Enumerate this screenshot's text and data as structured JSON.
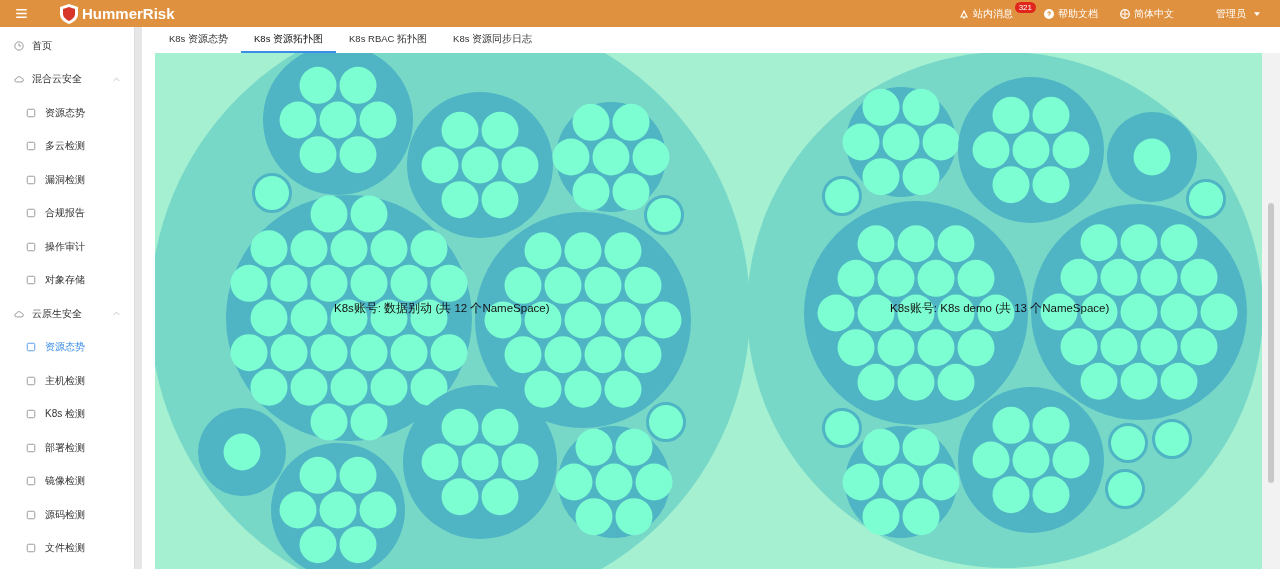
{
  "header": {
    "brand": "HummerRisk",
    "messages": {
      "label": "站内消息",
      "badge": "321"
    },
    "help": "帮助文档",
    "language": "简体中文",
    "user": "管理员"
  },
  "sidebar": {
    "items": [
      {
        "label": "首页",
        "selected": false
      },
      {
        "label": "混合云安全",
        "expanded": true,
        "children": [
          {
            "label": "资源态势",
            "selected": false
          },
          {
            "label": "多云检测",
            "selected": false
          },
          {
            "label": "漏洞检测",
            "selected": false
          },
          {
            "label": "合规报告",
            "selected": false
          },
          {
            "label": "操作审计",
            "selected": false
          },
          {
            "label": "对象存储",
            "selected": false
          }
        ]
      },
      {
        "label": "云原生安全",
        "expanded": true,
        "children": [
          {
            "label": "资源态势",
            "selected": true
          },
          {
            "label": "主机检测",
            "selected": false
          },
          {
            "label": "K8s 检测",
            "selected": false
          },
          {
            "label": "部署检测",
            "selected": false
          },
          {
            "label": "镜像检测",
            "selected": false
          },
          {
            "label": "源码检测",
            "selected": false
          },
          {
            "label": "文件检测",
            "selected": false
          }
        ]
      }
    ]
  },
  "tabs": [
    {
      "label": "K8s 资源态势",
      "selected": false
    },
    {
      "label": "K8s 资源拓扑图",
      "selected": true
    },
    {
      "label": "K8s RBAC 拓扑图",
      "selected": false
    },
    {
      "label": "K8s 资源同步日志",
      "selected": false
    }
  ],
  "topology": {
    "accounts": [
      {
        "label": "K8s账号: 数据别动 (共 12 个NameSpace)"
      },
      {
        "label": "K8s账号: K8s demo (共 13 个NameSpace)"
      }
    ]
  }
}
